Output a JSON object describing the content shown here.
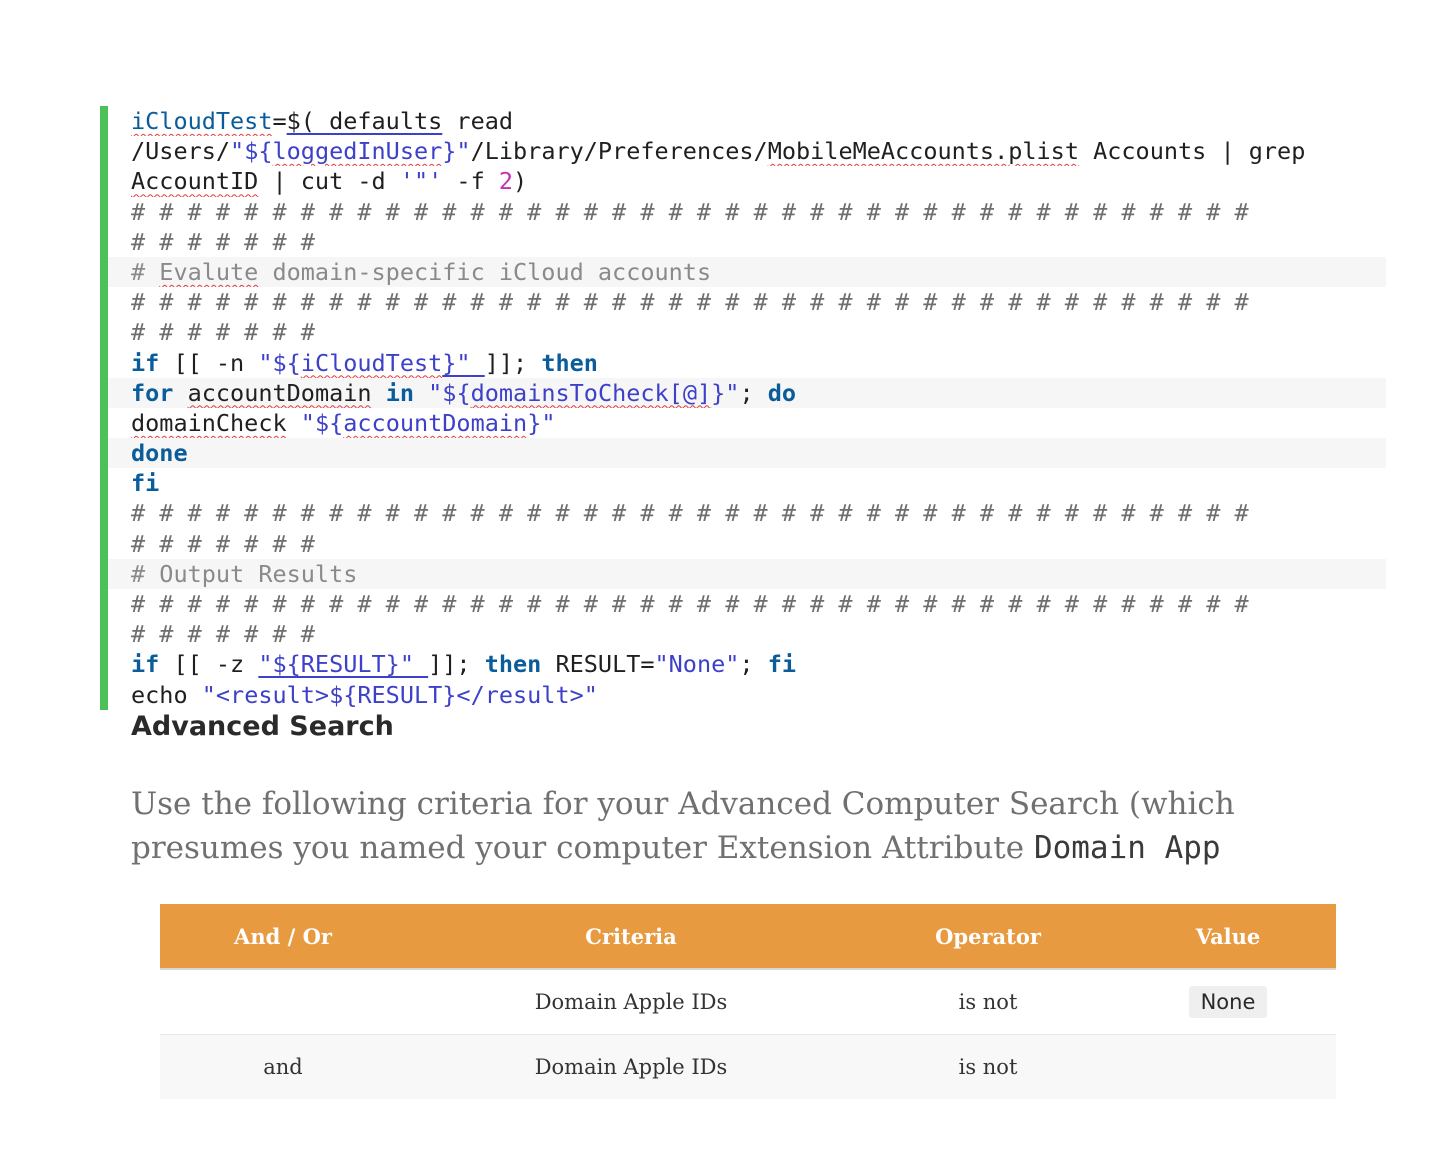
{
  "code": {
    "l1": {
      "a": "iCloudTest",
      "b": "=",
      "c": "$( defaults",
      "d": " read"
    },
    "l2": {
      "a": "/Users/",
      "b": "\"${",
      "c": "loggedInUser",
      "d": "}\"",
      "e": "/Library/Preferences/",
      "f": "MobileMeAccounts.plist",
      "g": " Accounts | grep"
    },
    "l3": {
      "a": "AccountID",
      "b": " | cut -d ",
      "c": "'\"'",
      "d": " -f ",
      "e": "2",
      "f": ")"
    },
    "hash_full": "# # # # # # # # # # # # # # # # # # # # # # # # # # # # # # # # # # # # # # # #",
    "hash_short": "# # # # # # #",
    "c1": {
      "a": "# ",
      "b": "Evalute",
      "c": " domain-specific iCloud accounts"
    },
    "l8": {
      "a": "if",
      "b": " [[ -n ",
      "c": "\"${",
      "d": "iCloudTest",
      "e": "}\"",
      "f": " ",
      "g": "]]; ",
      "h": "then"
    },
    "l9": {
      "a": "for",
      "b": " ",
      "c": "accountDomain",
      "d": " ",
      "e": "in",
      "f": " ",
      "g": "\"${",
      "h": "domainsToCheck[@]",
      "i": "}\"",
      "j": "; ",
      "k": "do"
    },
    "l10": {
      "a": "domainCheck",
      "b": " ",
      "c": "\"${",
      "d": "accountDomain",
      "e": "}\""
    },
    "l11": "done",
    "l12": "fi",
    "c2": "# Output Results",
    "l17": {
      "a": "if",
      "b": " [[ -z ",
      "c": "\"${RESULT}\"",
      "d": " ",
      "e": "]]; ",
      "f": "then",
      "g": " RESULT=",
      "h": "\"None\"",
      "i": "; ",
      "j": "fi"
    },
    "l18": {
      "a": "echo ",
      "b": "\"<result>${RESULT}</result>\""
    }
  },
  "heading": "Advanced Search",
  "paragraph": {
    "text": "Use the following criteria for your Advanced Computer Search (which presumes you named your computer Extension Attribute ",
    "code": "Domain App"
  },
  "table": {
    "headers": [
      "And / Or",
      "Criteria",
      "Operator",
      "Value"
    ],
    "rows": [
      [
        "",
        "Domain Apple IDs",
        "is not",
        "None"
      ],
      [
        "and",
        "Domain Apple IDs",
        "is not",
        ""
      ]
    ]
  },
  "colors": {
    "code_border": "#4cc15a",
    "table_header": "#e89a40",
    "keyword": "#0b5c9a",
    "string": "#3d41c9"
  }
}
